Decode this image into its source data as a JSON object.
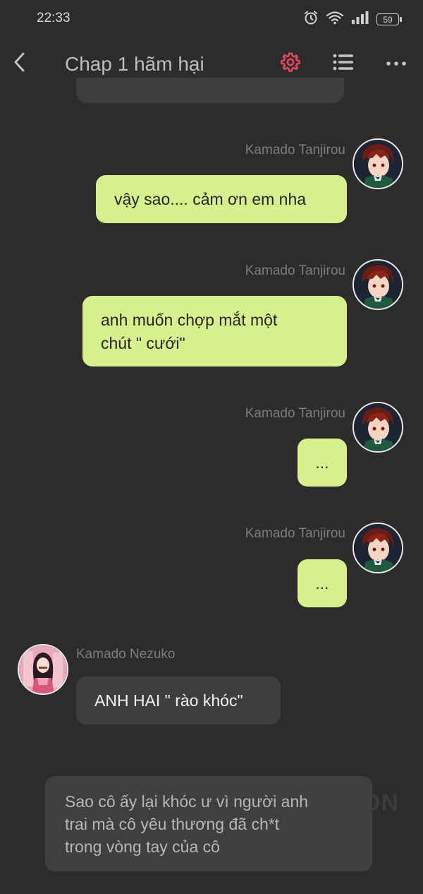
{
  "status_bar": {
    "time": "22:33",
    "battery": "59",
    "icons": [
      "alarm-icon",
      "wifi-icon",
      "signal-icon",
      "battery-icon"
    ]
  },
  "header": {
    "title": "Chap 1 hãm hại",
    "icons": [
      "back-arrow-icon",
      "gear-icon",
      "list-icon",
      "more-icon"
    ],
    "accent_color": "#e8465c"
  },
  "messages": [
    {
      "sender": "Kamado Tanjirou",
      "side": "right",
      "text": "vậy sao.... cảm ơn em nha"
    },
    {
      "sender": "Kamado Tanjirou",
      "side": "right",
      "line1": "anh muốn chợp mắt một",
      "line2": "chút \" cưới\""
    },
    {
      "sender": "Kamado Tanjirou",
      "side": "right",
      "text": "..."
    },
    {
      "sender": "Kamado Tanjirou",
      "side": "right",
      "text": "..."
    },
    {
      "sender": "Kamado Nezuko",
      "side": "left",
      "text": "ANH HAI \" rào khóc\""
    }
  ],
  "narration": {
    "line1": "Sao cô ấy lại khóc ư vì người anh",
    "line2": "trai mà cô yêu thương đã ch*t",
    "line3": "trong vòng tay của cô"
  },
  "watermark": "ON",
  "colors": {
    "background": "#2c2c2c",
    "outgoing_bubble": "#d7f08e",
    "incoming_bubble": "#3e3e3e",
    "narration_bubble": "#3f3f3f"
  }
}
